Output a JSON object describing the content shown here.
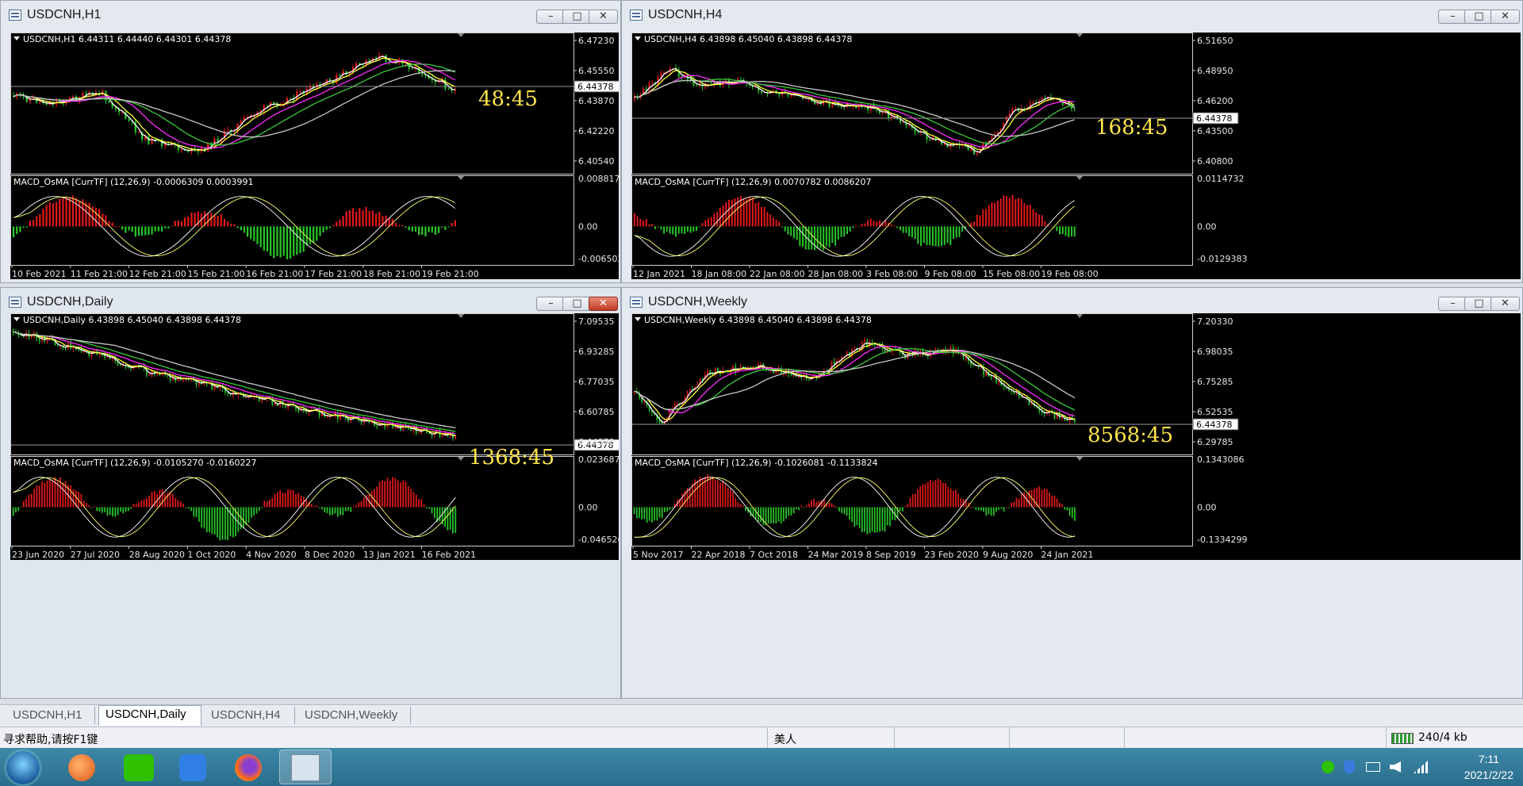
{
  "windows": [
    {
      "title": "USDCNH,H1",
      "header": "USDCNH,H1  6.44311 6.44440 6.44301 6.44378",
      "yticks": [
        "6.47230",
        "6.45550",
        "6.43870",
        "6.42220",
        "6.40540"
      ],
      "price_tag": "6.44378",
      "countdown": "48:45",
      "macd_header": "MACD_OsMA [CurrTF] (12,26,9) -0.0006309 0.0003991",
      "macd_yticks": [
        "0.0088172",
        "0.00",
        "-0.006502"
      ],
      "xticks": [
        "10 Feb 2021",
        "11 Feb 21:00",
        "12 Feb 21:00",
        "15 Feb 21:00",
        "16 Feb 21:00",
        "17 Feb 21:00",
        "18 Feb 21:00",
        "19 Feb 21:00"
      ]
    },
    {
      "title": "USDCNH,H4",
      "header": "USDCNH,H4  6.43898 6.45040 6.43898 6.44378",
      "yticks": [
        "6.51650",
        "6.48950",
        "6.46200",
        "6.43500",
        "6.40800"
      ],
      "price_tag": "6.44378",
      "countdown": "168:45",
      "macd_header": "MACD_OsMA [CurrTF] (12,26,9) 0.0070782 0.0086207",
      "macd_yticks": [
        "0.0114732",
        "0.00",
        "-0.0129383"
      ],
      "xticks": [
        "12 Jan 2021",
        "18 Jan 08:00",
        "22 Jan 08:00",
        "28 Jan 08:00",
        "3 Feb 08:00",
        "9 Feb 08:00",
        "15 Feb 08:00",
        "19 Feb 08:00"
      ]
    },
    {
      "title": "USDCNH,Daily",
      "header": "USDCNH,Daily  6.43898 6.45040 6.43898 6.44378",
      "yticks": [
        "7.09535",
        "6.93285",
        "6.77035",
        "6.60785",
        "6.44378"
      ],
      "price_tag": "6.44378",
      "countdown": "1368:45",
      "macd_header": "MACD_OsMA [CurrTF] (12,26,9) -0.0105270 -0.0160227",
      "macd_yticks": [
        "0.023687",
        "0.00",
        "-0.046526"
      ],
      "xticks": [
        "23 Jun 2020",
        "27 Jul 2020",
        "28 Aug 2020",
        "1 Oct 2020",
        "4 Nov 2020",
        "8 Dec 2020",
        "13 Jan 2021",
        "16 Feb 2021"
      ]
    },
    {
      "title": "USDCNH,Weekly",
      "header": "USDCNH,Weekly  6.43898 6.45040 6.43898 6.44378",
      "yticks": [
        "7.20330",
        "6.98035",
        "6.75285",
        "6.52535",
        "6.29785"
      ],
      "price_tag": "6.44378",
      "countdown": "8568:45",
      "macd_header": "MACD_OsMA [CurrTF] (12,26,9) -0.1026081 -0.1133824",
      "macd_yticks": [
        "0.1343086",
        "0.00",
        "-0.1334299"
      ],
      "xticks": [
        "5 Nov 2017",
        "22 Apr 2018",
        "7 Oct 2018",
        "24 Mar 2019",
        "8 Sep 2019",
        "23 Feb 2020",
        "9 Aug 2020",
        "24 Jan 2021"
      ]
    }
  ],
  "tabs": [
    "USDCNH,H1",
    "USDCNH,Daily",
    "USDCNH,H4",
    "USDCNH,Weekly"
  ],
  "active_tab": "USDCNH,Daily",
  "window_buttons": {
    "minimize": "–",
    "restore": "□",
    "close": "✕"
  },
  "status": {
    "help": "寻求帮助,请按F1键",
    "profile": "美人",
    "traffic": "240/4 kb"
  },
  "clock": {
    "time": "7:11",
    "date": "2021/2/22"
  },
  "colors": {
    "bull": "#e01818",
    "bear": "#27c427",
    "ma_fast": "#ffffff",
    "ma_yellow": "#ffff3c",
    "ma_magenta": "#ff2aff",
    "ma_green": "#3cc83c",
    "ma_gray": "#c8c8c8",
    "countdown": "#ffe44a"
  },
  "taskbar_icons": [
    "windows-start-icon",
    "media-player-icon",
    "wechat-icon",
    "notes-icon",
    "firefox-icon",
    "mt4-icon"
  ]
}
